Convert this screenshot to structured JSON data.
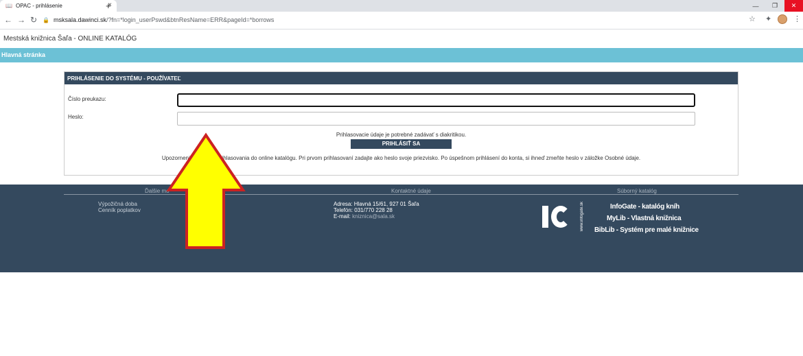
{
  "browser": {
    "tab_title": "OPAC - prihlásenie",
    "tab_close": "×",
    "new_tab": "+",
    "url_host": "msksala.dawinci.sk",
    "url_path": "/?fn=*login_userPswd&btnResName=ERR&pageId=*borrows",
    "window_minimize": "—",
    "window_restore": "❐",
    "window_close": "✕"
  },
  "site": {
    "title": "Mestská knižnica Šaľa - ONLINE KATALÓG",
    "nav_home": "Hlavná stránka"
  },
  "login": {
    "heading": "PRIHLÁSENIE DO SYSTÉMU - POUŽÍVATEĽ",
    "card_label": "Číslo preukazu:",
    "password_label": "Heslo:",
    "card_value": "",
    "password_value": "",
    "note": "Prihlasovacie údaje je potrebné zadávať s diakritikou.",
    "button": "PRIHLÁSIŤ SA",
    "warning": "Upozornenie o zmene prihlasovania do online katalógu. Pri prvom prihlasovaní zadajte ako heslo svoje priezvisko. Po úspešnom prihlásení do konta, si ihneď zmeňte heslo v záložke Osobné údaje."
  },
  "footer": {
    "col1_head": "Ďalšie mo",
    "col2_head": "Kontaktné údaje",
    "col3_head": "Súborný katalóg",
    "links": [
      "Výpožičná doba",
      "Cenník poplatkov"
    ],
    "address": "Adresa: Hlavná 15/61, 927 01 Šaľa",
    "phone": "Telefón: 031/770 228 28",
    "email_label": "E-mail:",
    "email": "kniznica@sala.sk",
    "ig_side_text": "www.infogate.sk",
    "products": [
      "InfoGate - katalóg kníh",
      "MyLib - Vlastná knižnica",
      "BibLib - Systém pre malé knižnice"
    ]
  },
  "colors": {
    "nav_band": "#6cc1d6",
    "dark_blue": "#34495e",
    "arrow_fill": "#ffff00",
    "arrow_stroke": "#cc2222"
  }
}
